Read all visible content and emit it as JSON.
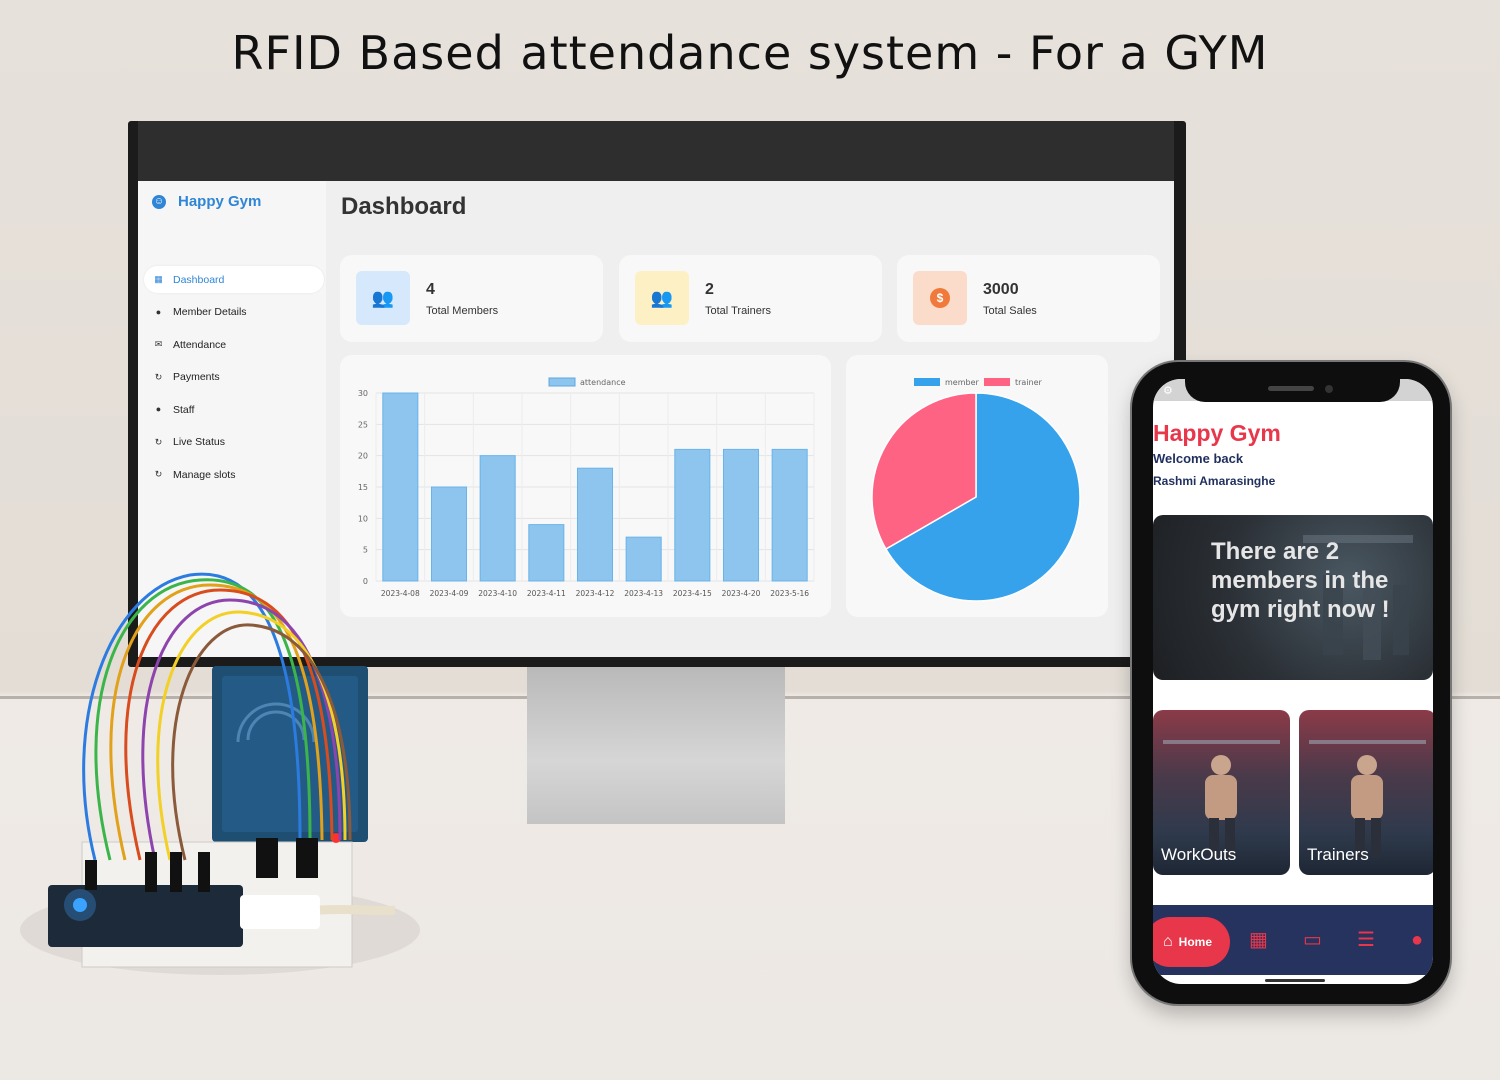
{
  "title": "RFID Based attendance system - For a GYM",
  "desktop": {
    "brand": "Happy Gym",
    "page_title": "Dashboard",
    "nav": [
      {
        "label": "Dashboard",
        "icon": "grid-icon",
        "active": true
      },
      {
        "label": "Member Details",
        "icon": "user-icon"
      },
      {
        "label": "Attendance",
        "icon": "mail-icon"
      },
      {
        "label": "Payments",
        "icon": "refresh-icon"
      },
      {
        "label": "Staff",
        "icon": "user-icon"
      },
      {
        "label": "Live Status",
        "icon": "refresh-icon"
      },
      {
        "label": "Manage slots",
        "icon": "refresh-icon"
      }
    ],
    "stats": [
      {
        "value": "4",
        "label": "Total Members",
        "icon": "users-icon",
        "color": "#2f86d6",
        "bg": "#d6e8fb"
      },
      {
        "value": "2",
        "label": "Total Trainers",
        "icon": "users-icon",
        "color": "#f2c025",
        "bg": "#fdf0c4"
      },
      {
        "value": "3000",
        "label": "Total Sales",
        "icon": "dollar-icon",
        "color": "#f07a3b",
        "bg": "#fbdccb"
      }
    ]
  },
  "chart_data": [
    {
      "type": "bar",
      "categories": [
        "2023-4-08",
        "2023-4-09",
        "2023-4-10",
        "2023-4-11",
        "2023-4-12",
        "2023-4-13",
        "2023-4-15",
        "2023-4-20",
        "2023-5-16"
      ],
      "series": [
        {
          "name": "attendance",
          "values": [
            30,
            15,
            20,
            9,
            18,
            7,
            21,
            21,
            21
          ],
          "color": "#8ec5ee"
        }
      ],
      "ylim": [
        0,
        30
      ],
      "yticks": [
        0,
        5,
        10,
        15,
        20,
        25,
        30
      ],
      "legend": "top",
      "grid": true
    },
    {
      "type": "pie",
      "series": [
        {
          "name": "member",
          "value": 2,
          "color": "#36a2eb"
        },
        {
          "name": "trainer",
          "value": 1,
          "color": "#ff6384"
        }
      ],
      "legend": "top"
    }
  ],
  "mobile": {
    "app_title": "Happy Gym",
    "welcome": "Welcome back",
    "user": "Rashmi Amarasinghe",
    "banner": "There are 2 members in the gym right now !",
    "tiles": [
      "WorkOuts",
      "Trainers"
    ],
    "bottom_nav": {
      "home_label": "Home",
      "icons": [
        "calendar-icon",
        "card-icon",
        "notes-icon",
        "profile-icon"
      ]
    }
  }
}
